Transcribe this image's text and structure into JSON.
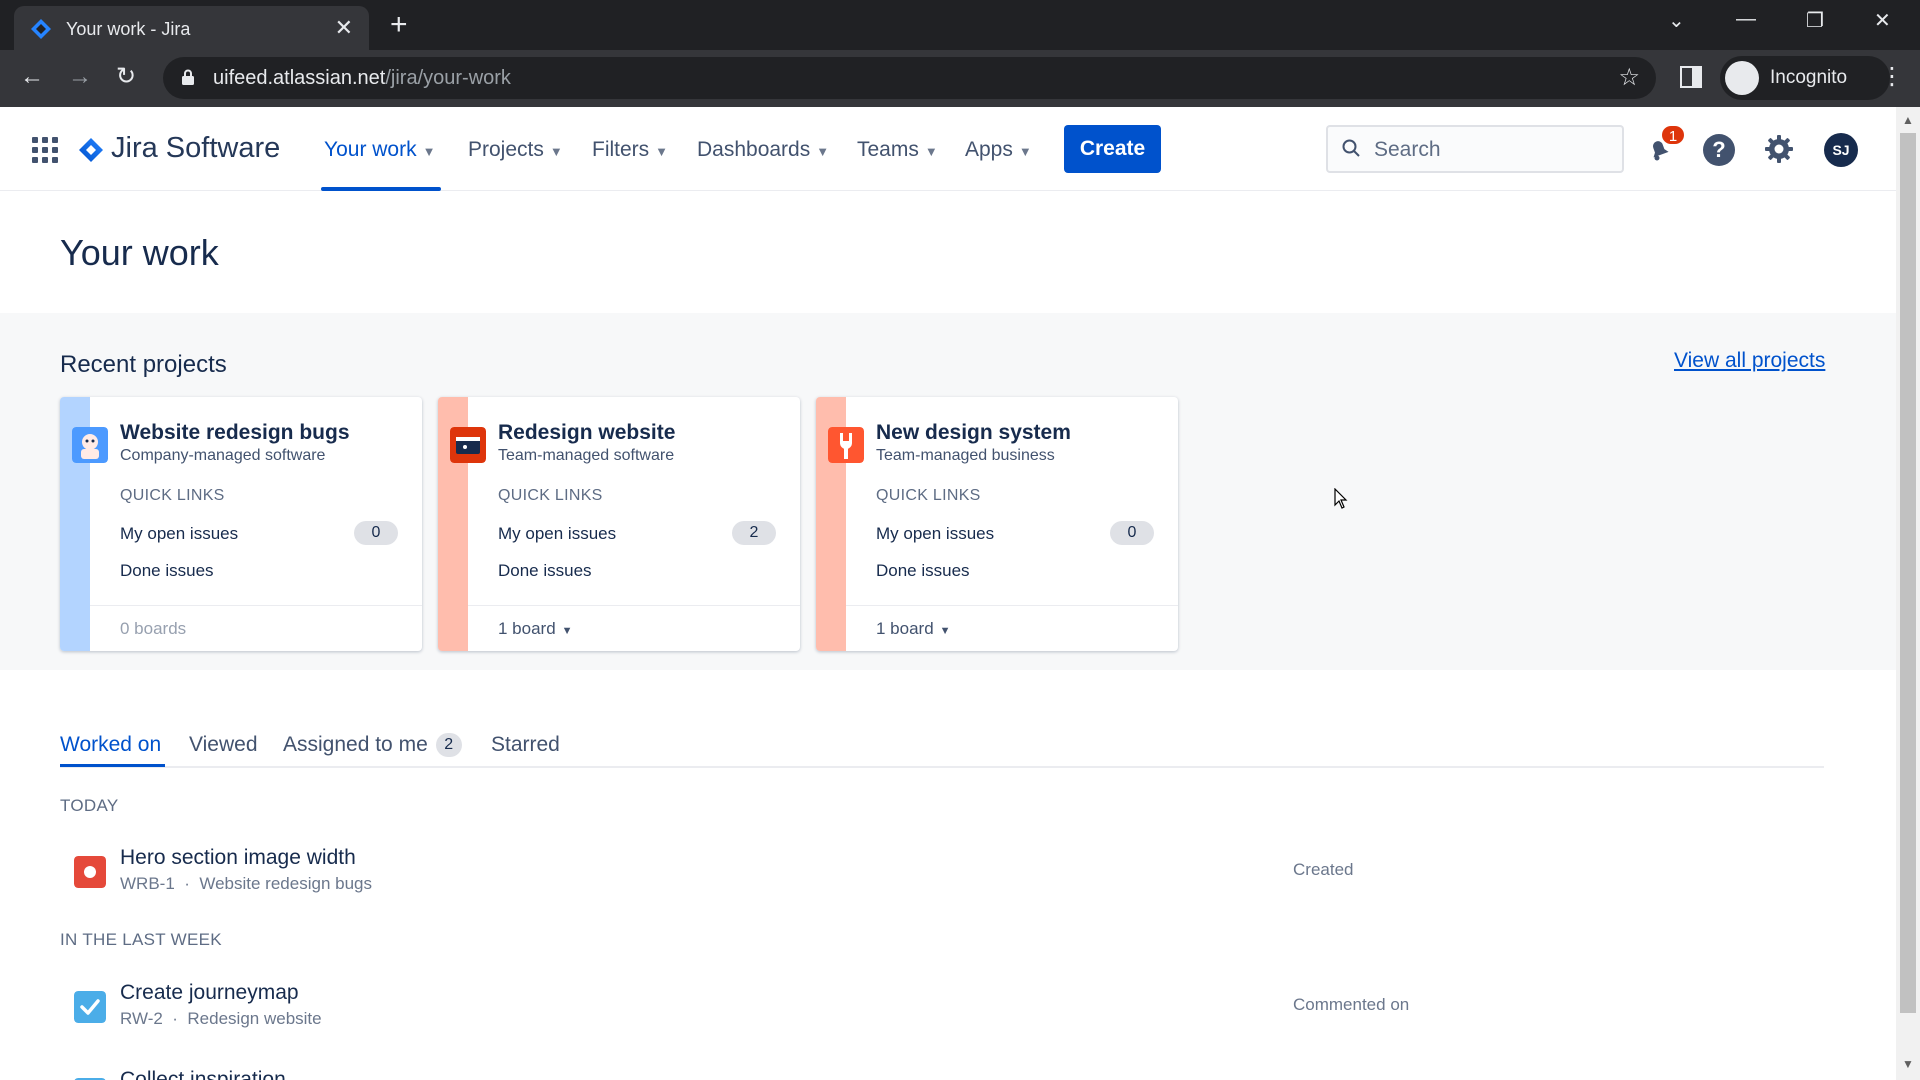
{
  "browser": {
    "tab_title": "Your work - Jira",
    "tab_close": "✕",
    "new_tab": "+",
    "url_host": "uifeed.atlassian.net",
    "url_path": "/jira/your-work",
    "profile_label": "Incognito",
    "window_controls": {
      "dropdown": "⌄",
      "minimize": "—",
      "restore": "❐",
      "close": "✕"
    },
    "nav_back": "←",
    "nav_forward": "→",
    "nav_reload": "↻",
    "bookmark_star": "☆",
    "menu": "⋮"
  },
  "header": {
    "logo_text": "Jira Software",
    "nav": [
      {
        "label": "Your work"
      },
      {
        "label": "Projects"
      },
      {
        "label": "Filters"
      },
      {
        "label": "Dashboards"
      },
      {
        "label": "Teams"
      },
      {
        "label": "Apps"
      }
    ],
    "create_label": "Create",
    "search_placeholder": "Search",
    "notification_count": "1",
    "help_glyph": "?",
    "avatar_initials": "SJ"
  },
  "page": {
    "title": "Your work",
    "recent_projects_title": "Recent projects",
    "view_all_label": "View all projects"
  },
  "projects": [
    {
      "name": "Website redesign bugs",
      "type": "Company-managed software",
      "quick_links_label": "QUICK LINKS",
      "open_issues_label": "My open issues",
      "open_issues_count": "0",
      "done_label": "Done issues",
      "boards_label": "0 boards",
      "stripe_color": "#b3d4ff",
      "icon_color": "#4c9aff"
    },
    {
      "name": "Redesign website",
      "type": "Team-managed software",
      "quick_links_label": "QUICK LINKS",
      "open_issues_label": "My open issues",
      "open_issues_count": "2",
      "done_label": "Done issues",
      "boards_label": "1 board",
      "stripe_color": "#ffbdad",
      "icon_color": "#de350b"
    },
    {
      "name": "New design system",
      "type": "Team-managed business",
      "quick_links_label": "QUICK LINKS",
      "open_issues_label": "My open issues",
      "open_issues_count": "0",
      "done_label": "Done issues",
      "boards_label": "1 board",
      "stripe_color": "#ffbdad",
      "icon_color": "#ff5630"
    }
  ],
  "work_tabs": {
    "worked_on": "Worked on",
    "viewed": "Viewed",
    "assigned": "Assigned to me",
    "assigned_count": "2",
    "starred": "Starred"
  },
  "worked_on": {
    "today_label": "TODAY",
    "last_week_label": "IN THE LAST WEEK",
    "items": [
      {
        "title": "Hero section image width",
        "key": "WRB-1",
        "project": "Website redesign bugs",
        "action": "Created",
        "icon_type": "bug"
      },
      {
        "title": "Create journeymap",
        "key": "RW-2",
        "project": "Redesign website",
        "action": "Commented on",
        "icon_type": "task"
      },
      {
        "title": "Collect inspiration",
        "key": "",
        "project": "",
        "action": "",
        "icon_type": "task"
      }
    ]
  },
  "meta_separator": "·"
}
